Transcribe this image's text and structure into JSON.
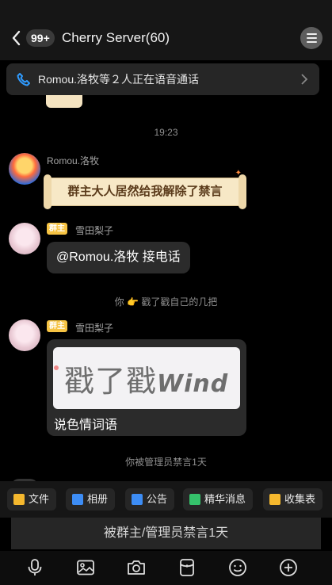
{
  "header": {
    "unread_badge": "99+",
    "title": "Cherry Server(60)"
  },
  "voice_bar": {
    "text": "Romou.洛牧等２人正在语音通话"
  },
  "chat": {
    "timestamp": "19:23",
    "messages": [
      {
        "sender": "Romou.洛牧",
        "text": "群主大人居然给我解除了禁言"
      },
      {
        "role": "群主",
        "sender": "雪田梨子",
        "text": "@Romou.洛牧 接电话"
      },
      {
        "role": "群主",
        "sender": "雪田梨子",
        "image_text": "戳了戳",
        "image_text_latin": "Wind",
        "caption": "说色情词语"
      }
    ],
    "system": [
      {
        "before": "你",
        "hand": "👉",
        "after": "戳了戳自己的几把"
      },
      {
        "text": "你被管理员禁言1天"
      }
    ]
  },
  "toolbar": {
    "items": [
      {
        "label": "文件",
        "color": "#f5b82e"
      },
      {
        "label": "相册",
        "color": "#3d8df5"
      },
      {
        "label": "公告",
        "color": "#3d8df5"
      },
      {
        "label": "精华消息",
        "color": "#35c26b"
      },
      {
        "label": "收集表",
        "color": "#f5b82e"
      }
    ]
  },
  "input": {
    "mute_notice": "被群主/管理员禁言1天"
  },
  "bottom_icons": [
    "microphone-icon",
    "image-icon",
    "camera-icon",
    "red-packet-icon",
    "emoji-icon",
    "plus-icon"
  ]
}
